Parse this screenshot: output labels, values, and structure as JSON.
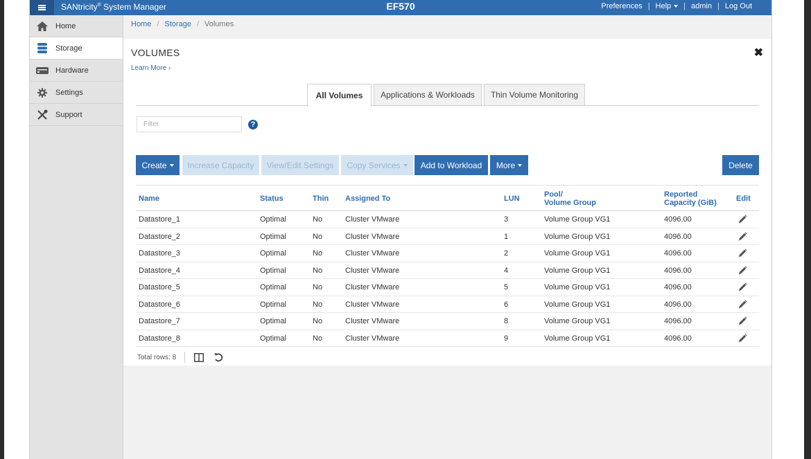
{
  "topbar": {
    "app_name": "SANtricity",
    "app_name_reg": "®",
    "app_name_suffix": " System Manager",
    "device": "EF570",
    "menu": {
      "preferences": "Preferences",
      "help": "Help",
      "user": "admin",
      "logout": "Log Out",
      "separator": "|"
    }
  },
  "sidebar": {
    "items": [
      {
        "label": "Home",
        "icon": "home-icon"
      },
      {
        "label": "Storage",
        "icon": "database-icon"
      },
      {
        "label": "Hardware",
        "icon": "hardware-icon"
      },
      {
        "label": "Settings",
        "icon": "gear-icon"
      },
      {
        "label": "Support",
        "icon": "tools-icon"
      }
    ]
  },
  "breadcrumb": {
    "home": "Home",
    "storage": "Storage",
    "current": "Volumes",
    "separator": "/"
  },
  "page": {
    "title": "VOLUMES",
    "learn_more": "Learn More ›",
    "close": "✖"
  },
  "tabs": {
    "all_volumes": "All Volumes",
    "applications": "Applications & Workloads",
    "thin_monitoring": "Thin Volume Monitoring"
  },
  "filter": {
    "placeholder": "Filter",
    "help": "?"
  },
  "toolbar": {
    "create": "Create",
    "increase_capacity": "Increase Capacity",
    "view_edit": "View/Edit Settings",
    "copy_services": "Copy Services",
    "add_to_workload": "Add to Workload",
    "more": "More",
    "delete": "Delete"
  },
  "colors": {
    "brand_blue": "#2f6db0",
    "disabled_blue": "#d3e3f1"
  },
  "table": {
    "headers": {
      "name": "Name",
      "status": "Status",
      "thin": "Thin",
      "assigned_to": "Assigned To",
      "lun": "LUN",
      "pool_line1": "Pool/",
      "pool_line2": "Volume Group",
      "capacity_line1": "Reported",
      "capacity_line2": "Capacity (GiB)",
      "edit": "Edit"
    },
    "rows": [
      {
        "name": "Datastore_1",
        "status": "Optimal",
        "thin": "No",
        "assigned": "Cluster VMware",
        "lun": "3",
        "pool": "Volume Group VG1",
        "capacity": "4096.00"
      },
      {
        "name": "Datastore_2",
        "status": "Optimal",
        "thin": "No",
        "assigned": "Cluster VMware",
        "lun": "1",
        "pool": "Volume Group VG1",
        "capacity": "4096.00"
      },
      {
        "name": "Datastore_3",
        "status": "Optimal",
        "thin": "No",
        "assigned": "Cluster VMware",
        "lun": "2",
        "pool": "Volume Group VG1",
        "capacity": "4096.00"
      },
      {
        "name": "Datastore_4",
        "status": "Optimal",
        "thin": "No",
        "assigned": "Cluster VMware",
        "lun": "4",
        "pool": "Volume Group VG1",
        "capacity": "4096.00"
      },
      {
        "name": "Datastore_5",
        "status": "Optimal",
        "thin": "No",
        "assigned": "Cluster VMware",
        "lun": "5",
        "pool": "Volume Group VG1",
        "capacity": "4096.00"
      },
      {
        "name": "Datastore_6",
        "status": "Optimal",
        "thin": "No",
        "assigned": "Cluster VMware",
        "lun": "6",
        "pool": "Volume Group VG1",
        "capacity": "4096.00"
      },
      {
        "name": "Datastore_7",
        "status": "Optimal",
        "thin": "No",
        "assigned": "Cluster VMware",
        "lun": "8",
        "pool": "Volume Group VG1",
        "capacity": "4096.00"
      },
      {
        "name": "Datastore_8",
        "status": "Optimal",
        "thin": "No",
        "assigned": "Cluster VMware",
        "lun": "9",
        "pool": "Volume Group VG1",
        "capacity": "4096.00"
      }
    ]
  },
  "footer": {
    "total_rows": "Total rows: 8",
    "columns_icon": "columns-icon",
    "refresh_icon": "refresh-icon"
  }
}
